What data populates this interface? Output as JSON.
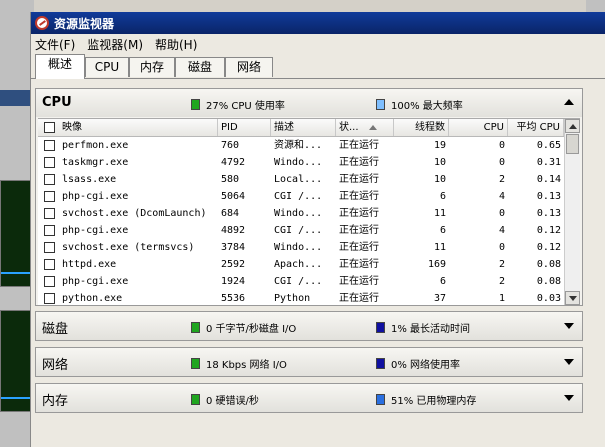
{
  "window": {
    "title": "资源监视器"
  },
  "menu": [
    "文件(F)",
    "监视器(M)",
    "帮助(H)"
  ],
  "tabs": [
    "概述",
    "CPU",
    "内存",
    "磁盘",
    "网络"
  ],
  "cpu": {
    "title": "CPU",
    "stat1": "27% CPU 使用率",
    "stat2": "100% 最大频率",
    "stat1_color": "#1fa51f",
    "stat2_color": "#7fbfff",
    "columns": [
      "映像",
      "PID",
      "描述",
      "状...",
      "线程数",
      "CPU",
      "平均 CPU"
    ],
    "rows": [
      {
        "image": "perfmon.exe",
        "pid": "760",
        "desc": "资源和...",
        "status": "正在运行",
        "threads": "19",
        "cpu": "0",
        "avg": "0.65"
      },
      {
        "image": "taskmgr.exe",
        "pid": "4792",
        "desc": "Windo...",
        "status": "正在运行",
        "threads": "10",
        "cpu": "0",
        "avg": "0.31"
      },
      {
        "image": "lsass.exe",
        "pid": "580",
        "desc": "Local...",
        "status": "正在运行",
        "threads": "10",
        "cpu": "2",
        "avg": "0.14"
      },
      {
        "image": "php-cgi.exe",
        "pid": "5064",
        "desc": "CGI /...",
        "status": "正在运行",
        "threads": "6",
        "cpu": "4",
        "avg": "0.13"
      },
      {
        "image": "svchost.exe (DcomLaunch)",
        "pid": "684",
        "desc": "Windo...",
        "status": "正在运行",
        "threads": "11",
        "cpu": "0",
        "avg": "0.13"
      },
      {
        "image": "php-cgi.exe",
        "pid": "4892",
        "desc": "CGI /...",
        "status": "正在运行",
        "threads": "6",
        "cpu": "4",
        "avg": "0.12"
      },
      {
        "image": "svchost.exe (termsvcs)",
        "pid": "3784",
        "desc": "Windo...",
        "status": "正在运行",
        "threads": "11",
        "cpu": "0",
        "avg": "0.12"
      },
      {
        "image": "httpd.exe",
        "pid": "2592",
        "desc": "Apach...",
        "status": "正在运行",
        "threads": "169",
        "cpu": "2",
        "avg": "0.08"
      },
      {
        "image": "php-cgi.exe",
        "pid": "1924",
        "desc": "CGI /...",
        "status": "正在运行",
        "threads": "6",
        "cpu": "2",
        "avg": "0.08"
      },
      {
        "image": "python.exe",
        "pid": "5536",
        "desc": "Python",
        "status": "正在运行",
        "threads": "37",
        "cpu": "1",
        "avg": "0.03"
      }
    ]
  },
  "disk": {
    "title": "磁盘",
    "stat1": "0 千字节/秒磁盘 I/O",
    "stat2": "1% 最长活动时间",
    "stat1_color": "#1fa51f",
    "stat2_color": "#1010a0"
  },
  "network": {
    "title": "网络",
    "stat1": "18 Kbps 网络 I/O",
    "stat2": "0% 网络使用率",
    "stat1_color": "#1fa51f",
    "stat2_color": "#1010a0"
  },
  "memory": {
    "title": "内存",
    "stat1": "0 硬错误/秒",
    "stat2": "51% 已用物理内存",
    "stat1_color": "#1fa51f",
    "stat2_color": "#2a6fe0"
  }
}
